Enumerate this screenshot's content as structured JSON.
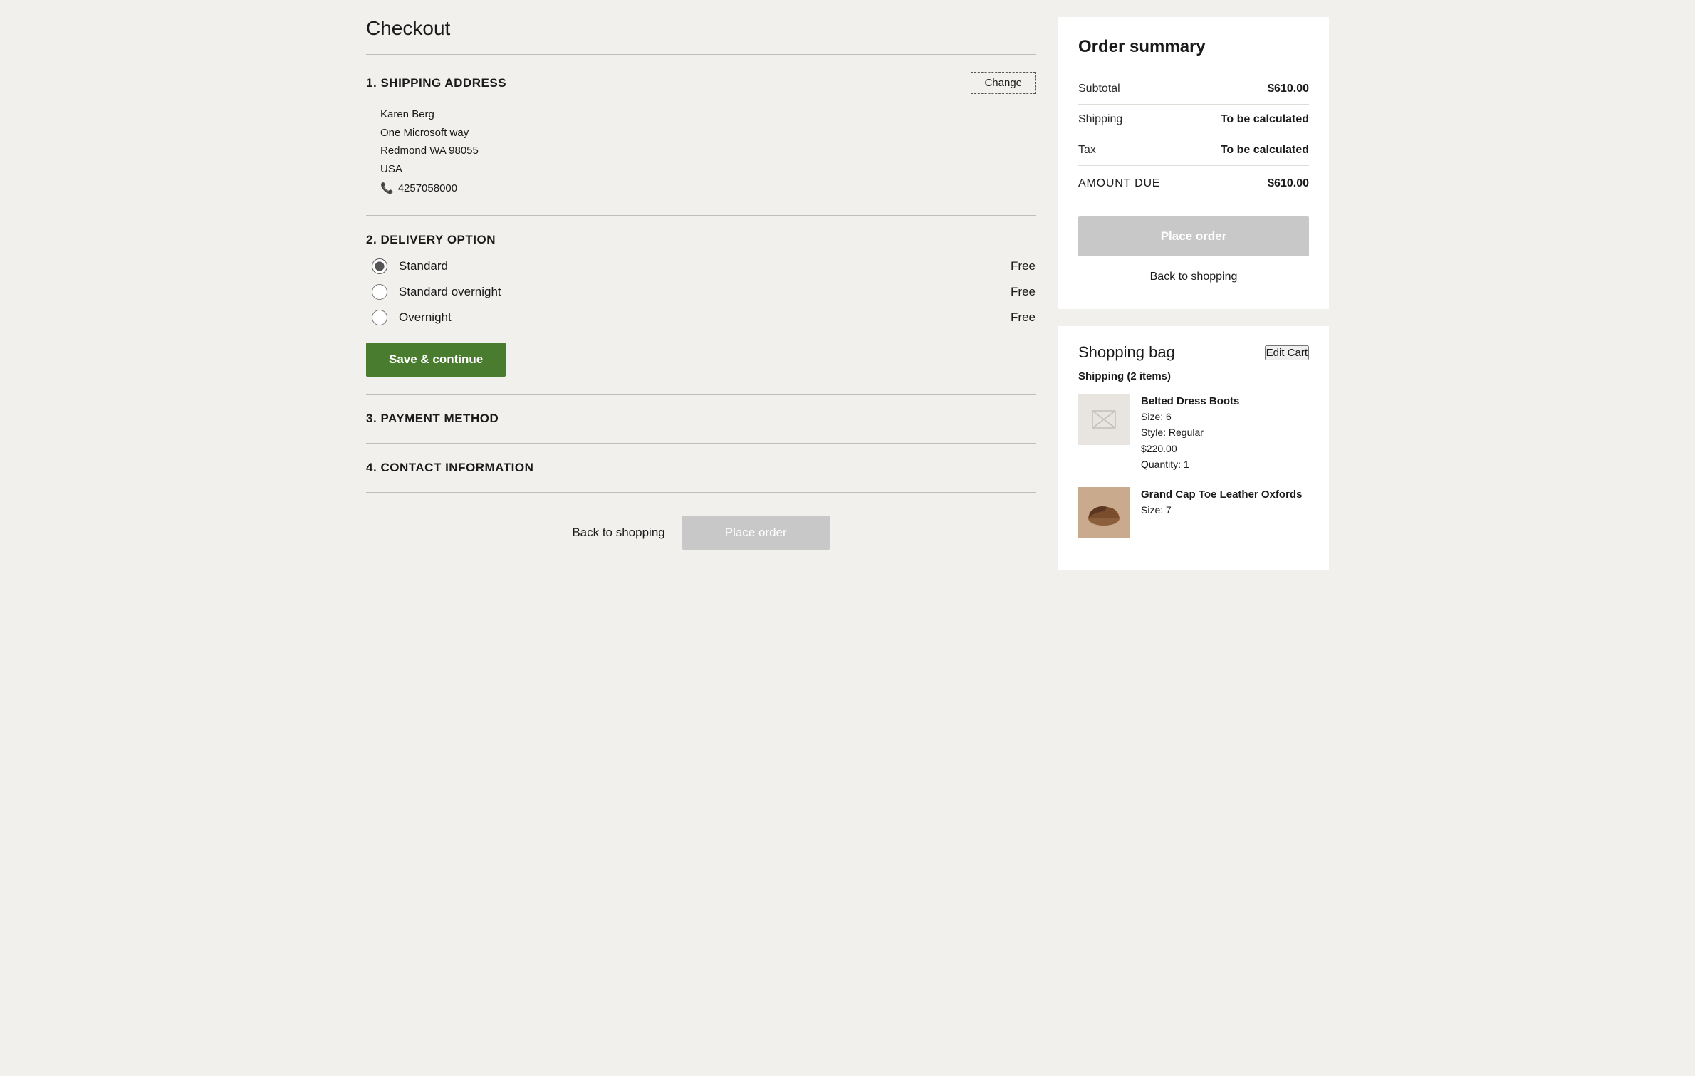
{
  "page": {
    "title": "Checkout"
  },
  "shipping_address": {
    "section_number": "1.",
    "section_title": "SHIPPING ADDRESS",
    "change_label": "Change",
    "name": "Karen Berg",
    "address_line1": "One Microsoft way",
    "address_line2": "Redmond WA  98055",
    "country": "USA",
    "phone": "4257058000"
  },
  "delivery_option": {
    "section_number": "2.",
    "section_title": "DELIVERY OPTION",
    "options": [
      {
        "id": "standard",
        "label": "Standard",
        "price": "Free",
        "checked": true
      },
      {
        "id": "standard_overnight",
        "label": "Standard overnight",
        "price": "Free",
        "checked": false
      },
      {
        "id": "overnight",
        "label": "Overnight",
        "price": "Free",
        "checked": false
      }
    ],
    "save_button_label": "Save & continue"
  },
  "payment_method": {
    "section_number": "3.",
    "section_title": "PAYMENT METHOD"
  },
  "contact_information": {
    "section_number": "4.",
    "section_title": "CONTACT INFORMATION"
  },
  "bottom_actions": {
    "back_label": "Back to shopping",
    "place_order_label": "Place order"
  },
  "order_summary": {
    "title": "Order summary",
    "subtotal_label": "Subtotal",
    "subtotal_value": "$610.00",
    "shipping_label": "Shipping",
    "shipping_value": "To be calculated",
    "tax_label": "Tax",
    "tax_value": "To be calculated",
    "amount_due_label": "AMOUNT DUE",
    "amount_due_value": "$610.00",
    "place_order_label": "Place order",
    "back_label": "Back to shopping"
  },
  "shopping_bag": {
    "title": "Shopping bag",
    "edit_cart_label": "Edit Cart",
    "items_label": "Shipping (2 items)",
    "items": [
      {
        "name": "Belted Dress Boots",
        "size": "Size: 6",
        "style": "Style: Regular",
        "price": "$220.00",
        "quantity": "Quantity: 1",
        "has_image": false
      },
      {
        "name": "Grand Cap Toe Leather Oxfords",
        "size": "Size: 7",
        "has_image": true
      }
    ]
  }
}
